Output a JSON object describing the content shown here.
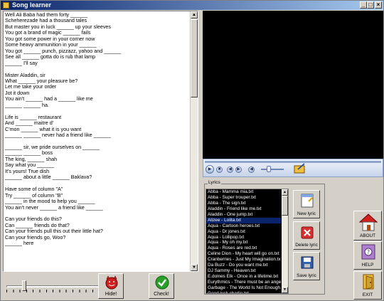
{
  "window": {
    "title": "Song learner"
  },
  "lyrics": {
    "lines": [
      "Well Ali Baba had them forty ______",
      "Scheherezade had a thousand tales",
      "But master you in luck ______ up your sleeves",
      "You got a brand of magic ______ fails",
      "You got some power in your corner now",
      "Some heavy ammunition in your ______",
      "You got ______ punch, pizzazz, yahoo and ______",
      "See all ______ gotta do is rub that lamp",
      "______ I'll say",
      "",
      "Mister Aladdin, sir",
      "What ______ your pleasure be?",
      "Let me take your order",
      "Jot it down",
      "You ain't ______ had a ______ like me",
      "______ ______ ha.",
      "",
      "Life is ______ restaurant",
      "And ______ maitre d'",
      "C'mon ______ what it is you want",
      "______ ______ never had a friend like ______",
      "",
      "______ sir, we pride ourselves on ______",
      "______ ______ boss",
      "The king, ______ shah",
      "Say what you ______",
      "It's yours! True dish",
      "______ about a little ______ Baklava?",
      "",
      "Have some of column \"A\"",
      "Try ______ of column \"B\"",
      "______ in the mood to help you ______",
      "You ain't never ______ a friend like ______",
      "",
      "Can your friends do this?",
      "Can ______ friends do that?",
      "Can your friends pull this out their little hat?",
      "Can your friends go, Woo?",
      "______ here"
    ]
  },
  "controls": {
    "hide_label": "Hide!",
    "check_label": "Check!",
    "about_label": "ABOUT",
    "help_label": "HELP",
    "exit_label": "EXIT",
    "new_lyric_label": "New lyric",
    "delete_lyric_label": "Delete lyric",
    "save_lyric_label": "Save lyric"
  },
  "lyrics_panel": {
    "legend": "Lyrics",
    "selected_index": 5,
    "items": [
      "Abba - Mamma mia.txt",
      "Abba - Super trouper.txt",
      "Abba - The sign.txt",
      "Aladdin - Friend like me.txt",
      "Aladdin - One jump.txt",
      "Alizee - Lolita.txt",
      "Aqua - Cartoon heroes.txt",
      "Aqua - Dr jones.txt",
      "Aqua - Lollipop.txt",
      "Aqua - My oh my.txt",
      "Aqua - Roses are red.txt",
      "Celine Dion - My heart will go on.txt",
      "Cranberries - Just My Imagination.txt",
      "Da Buzz - Do you want me.txt",
      "DJ Sammy - Heaven.txt",
      "E.dolnes Elk - Once in a lifetime.txt",
      "Eurythmics - There must be an angel.txt",
      "Garbage - The World Is Not Enough.txt",
      "Good luck charlie.txt"
    ]
  },
  "player": {
    "buttons": [
      "play",
      "stop",
      "prev",
      "next",
      "mute"
    ]
  },
  "colors": {
    "titlebar": "#0a246a",
    "list_bg": "#000000",
    "list_sel": "#0a246a",
    "video_bg": "#000000"
  }
}
